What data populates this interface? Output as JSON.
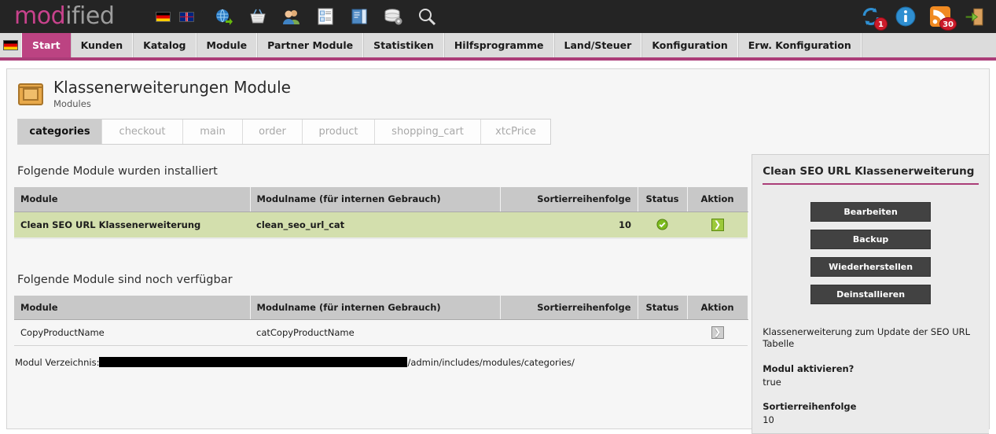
{
  "brand": {
    "part1": "mod",
    "part2": "ified"
  },
  "accent_color": "#ab3d78",
  "topbar": {
    "languages": [
      {
        "name": "flag-de-icon",
        "label": "Deutsch"
      },
      {
        "name": "flag-gb-icon",
        "label": "English"
      }
    ],
    "tools": [
      {
        "name": "globe-shop-icon",
        "label": "Shop aufrufen"
      },
      {
        "name": "basket-icon",
        "label": "Bestellungen"
      },
      {
        "name": "customers-icon",
        "label": "Kunden"
      },
      {
        "name": "catalog-icon",
        "label": "Katalog"
      },
      {
        "name": "content-icon",
        "label": "Inhalte"
      },
      {
        "name": "database-icon",
        "label": "Datenbank"
      },
      {
        "name": "search-icon",
        "label": "Suche"
      }
    ],
    "right_icons": [
      {
        "name": "update-icon",
        "badge": "1"
      },
      {
        "name": "info-icon",
        "badge": ""
      },
      {
        "name": "rss-icon",
        "badge": "30"
      },
      {
        "name": "logout-icon",
        "badge": ""
      }
    ]
  },
  "nav": {
    "flag_icon": "flag-de-icon",
    "items": [
      {
        "label": "Start",
        "active": true
      },
      {
        "label": "Kunden",
        "active": false
      },
      {
        "label": "Katalog",
        "active": false
      },
      {
        "label": "Module",
        "active": false
      },
      {
        "label": "Partner Module",
        "active": false
      },
      {
        "label": "Statistiken",
        "active": false
      },
      {
        "label": "Hilfsprogramme",
        "active": false
      },
      {
        "label": "Land/Steuer",
        "active": false
      },
      {
        "label": "Konfiguration",
        "active": false
      },
      {
        "label": "Erw. Konfiguration",
        "active": false
      }
    ]
  },
  "page": {
    "icon": "module-box-icon",
    "title": "Klassenerweiterungen Module",
    "subtitle": "Modules"
  },
  "tabs": [
    {
      "label": "categories",
      "active": true
    },
    {
      "label": "checkout",
      "active": false
    },
    {
      "label": "main",
      "active": false
    },
    {
      "label": "order",
      "active": false
    },
    {
      "label": "product",
      "active": false
    },
    {
      "label": "shopping_cart",
      "active": false
    },
    {
      "label": "xtcPrice",
      "active": false
    }
  ],
  "installed": {
    "heading": "Folgende Module wurden installiert",
    "columns": [
      "Module",
      "Modulname (für internen Gebrauch)",
      "Sortierreihenfolge",
      "Status",
      "Aktion"
    ],
    "rows": [
      {
        "module": "Clean SEO URL Klassenerweiterung",
        "internal_name": "clean_seo_url_cat",
        "sort_order": "10",
        "status": "enabled",
        "action": "edit-arrow"
      }
    ]
  },
  "available": {
    "heading": "Folgende Module sind noch verfügbar",
    "columns": [
      "Module",
      "Modulname (für internen Gebrauch)",
      "Sortierreihenfolge",
      "Status",
      "Aktion"
    ],
    "rows": [
      {
        "module": "CopyProductName",
        "internal_name": "catCopyProductName",
        "sort_order": "",
        "status": "",
        "action": "install-arrow"
      }
    ]
  },
  "module_dir": {
    "label": "Modul Verzeichnis:",
    "redacted": true,
    "path": "/admin/includes/modules/categories/"
  },
  "right_panel": {
    "title": "Clean SEO URL Klassenerweiterung",
    "buttons": [
      {
        "label": "Bearbeiten"
      },
      {
        "label": "Backup"
      },
      {
        "label": "Wiederherstellen"
      },
      {
        "label": "Deinstallieren"
      }
    ],
    "description": "Klassenerweiterung zum Update der SEO URL Tabelle",
    "fields": [
      {
        "key": "Modul aktivieren?",
        "value": "true"
      },
      {
        "key": "Sortierreihenfolge",
        "value": "10"
      }
    ]
  }
}
